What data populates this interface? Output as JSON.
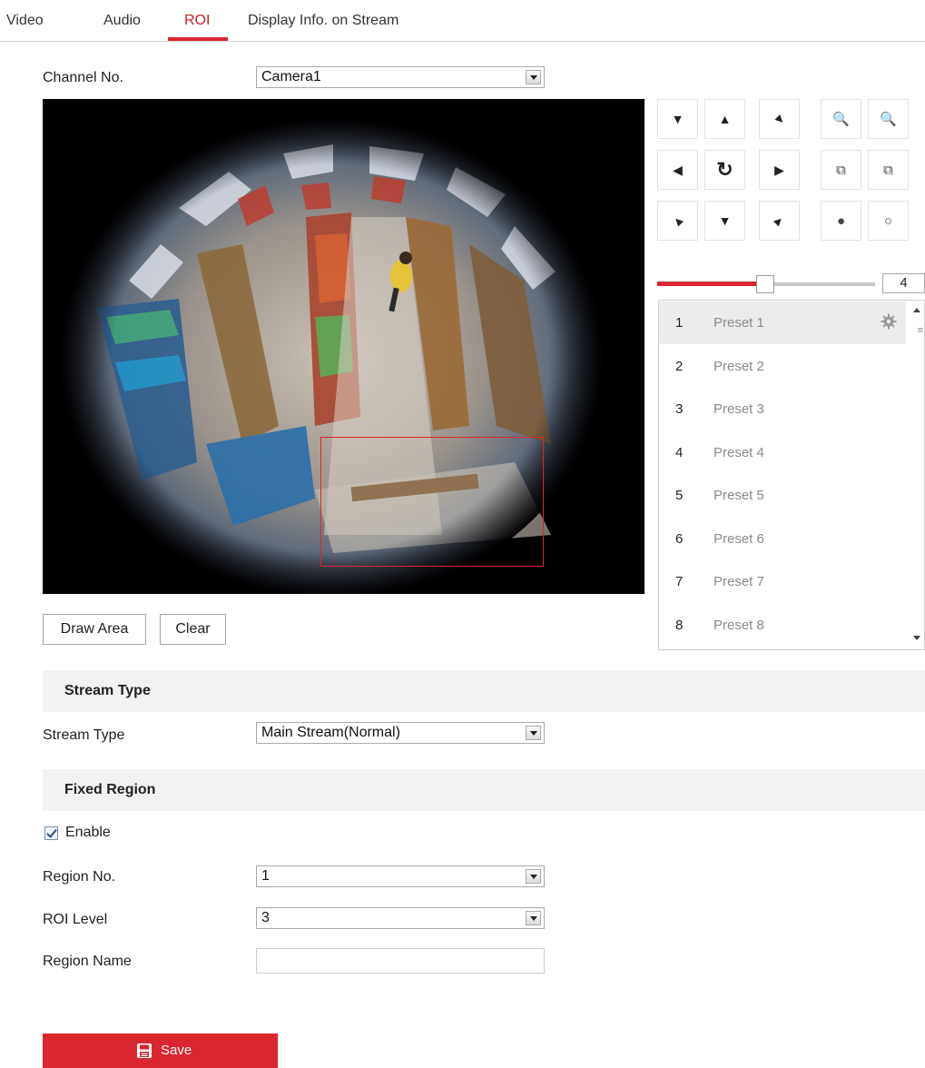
{
  "tabs": [
    {
      "label": "Video"
    },
    {
      "label": "Audio"
    },
    {
      "label": "ROI"
    },
    {
      "label": "Display Info. on Stream"
    }
  ],
  "active_tab": "ROI",
  "channel": {
    "label": "Channel No.",
    "value": "Camera1"
  },
  "video": {
    "roi_overlay_color": "#e0242c"
  },
  "actions": {
    "draw_area": "Draw Area",
    "clear": "Clear"
  },
  "ptz": {
    "icons": [
      "arrow-up-left-icon",
      "arrow-up-icon",
      "arrow-up-right-icon",
      "zoom-out-icon",
      "zoom-in-icon",
      "arrow-left-icon",
      "auto-rotate-icon",
      "arrow-right-icon",
      "focus-near-icon",
      "focus-far-icon",
      "arrow-down-left-icon",
      "arrow-down-icon",
      "arrow-down-right-icon",
      "iris-close-icon",
      "iris-open-icon"
    ],
    "speed": "4",
    "speed_fraction": 0.5
  },
  "presets": [
    {
      "num": "1",
      "name": "Preset 1"
    },
    {
      "num": "2",
      "name": "Preset 2"
    },
    {
      "num": "3",
      "name": "Preset 3"
    },
    {
      "num": "4",
      "name": "Preset 4"
    },
    {
      "num": "5",
      "name": "Preset 5"
    },
    {
      "num": "6",
      "name": "Preset 6"
    },
    {
      "num": "7",
      "name": "Preset 7"
    },
    {
      "num": "8",
      "name": "Preset 8"
    }
  ],
  "stream_section": {
    "title": "Stream Type",
    "label": "Stream Type",
    "value": "Main Stream(Normal)"
  },
  "fixed_section": {
    "title": "Fixed Region",
    "enable_label": "Enable",
    "enabled": true,
    "region_no": {
      "label": "Region No.",
      "value": "1"
    },
    "roi_level": {
      "label": "ROI Level",
      "value": "3"
    },
    "region_name": {
      "label": "Region Name",
      "value": ""
    }
  },
  "save": {
    "label": "Save"
  },
  "colors": {
    "accent": "#d9262f",
    "section_bg": "#f2f2f2"
  }
}
